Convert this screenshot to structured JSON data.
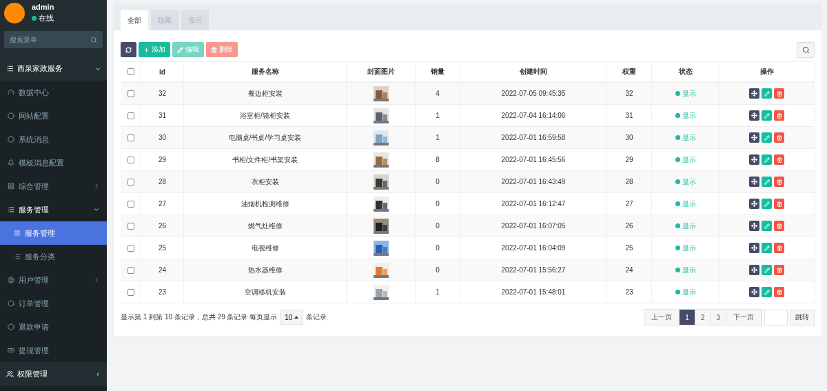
{
  "sidebar": {
    "user": {
      "name": "admin",
      "status": "在线",
      "online": true
    },
    "search": {
      "placeholder": "搜索菜单"
    },
    "menu": [
      {
        "label": "西泉家政服务",
        "expanded": true,
        "children": [
          {
            "label": "数据中心",
            "selected": false
          },
          {
            "label": "网站配置",
            "selected": false
          },
          {
            "label": "系统消息",
            "selected": false
          },
          {
            "label": "模板消息配置",
            "selected": false
          },
          {
            "label": "综合管理",
            "selected": false,
            "expanded": false
          },
          {
            "label": "服务管理",
            "selected": false,
            "expanded": true,
            "children": [
              {
                "label": "服务管理",
                "selected": true
              },
              {
                "label": "服务分类",
                "selected": false
              }
            ]
          },
          {
            "label": "用户管理",
            "selected": false,
            "expanded": false
          },
          {
            "label": "订单管理",
            "selected": false
          },
          {
            "label": "退款申请",
            "selected": false
          },
          {
            "label": "提现管理",
            "selected": false
          }
        ]
      },
      {
        "label": "权限管理",
        "expanded": false
      }
    ]
  },
  "tabs": [
    {
      "label": "全部",
      "selected": true
    },
    {
      "label": "隐藏",
      "selected": false
    },
    {
      "label": "显示",
      "selected": false
    }
  ],
  "toolbar": [
    {
      "kind": "refresh",
      "disabled": false
    },
    {
      "kind": "add",
      "label": "添加",
      "disabled": false
    },
    {
      "kind": "edit",
      "label": "编辑",
      "disabled": true
    },
    {
      "kind": "delete",
      "label": "删除",
      "disabled": true
    }
  ],
  "table": {
    "header_checked": false,
    "columns": [
      "id",
      "服务名称",
      "封面图片",
      "销量",
      "创建时间",
      "权重",
      "状态",
      "操作"
    ],
    "rows": [
      {
        "checked": false,
        "id": "32",
        "name": "餐边柜安装",
        "sales": "4",
        "created": "2022-07-05 09:45:35",
        "weight": "32",
        "status": {
          "label": "显示",
          "on": true
        }
      },
      {
        "checked": false,
        "id": "31",
        "name": "浴室柜/镜柜安装",
        "sales": "1",
        "created": "2022-07-04 16:14:06",
        "weight": "31",
        "status": {
          "label": "显示",
          "on": true
        }
      },
      {
        "checked": false,
        "id": "30",
        "name": "电脑桌/书桌/学习桌安装",
        "sales": "1",
        "created": "2022-07-01 16:59:58",
        "weight": "30",
        "status": {
          "label": "显示",
          "on": true
        }
      },
      {
        "checked": false,
        "id": "29",
        "name": "书柜/文件柜/书架安装",
        "sales": "8",
        "created": "2022-07-01 16:45:56",
        "weight": "29",
        "status": {
          "label": "显示",
          "on": true
        }
      },
      {
        "checked": false,
        "id": "28",
        "name": "衣柜安装",
        "sales": "0",
        "created": "2022-07-01 16:43:49",
        "weight": "28",
        "status": {
          "label": "显示",
          "on": true
        }
      },
      {
        "checked": false,
        "id": "27",
        "name": "油烟机检测维修",
        "sales": "0",
        "created": "2022-07-01 16:12:47",
        "weight": "27",
        "status": {
          "label": "显示",
          "on": true
        }
      },
      {
        "checked": false,
        "id": "26",
        "name": "燃气灶维修",
        "sales": "0",
        "created": "2022-07-01 16:07:05",
        "weight": "26",
        "status": {
          "label": "显示",
          "on": true
        }
      },
      {
        "checked": false,
        "id": "25",
        "name": "电视维修",
        "sales": "0",
        "created": "2022-07-01 16:04:09",
        "weight": "25",
        "status": {
          "label": "显示",
          "on": true
        }
      },
      {
        "checked": false,
        "id": "24",
        "name": "热水器维修",
        "sales": "0",
        "created": "2022-07-01 15:56:27",
        "weight": "24",
        "status": {
          "label": "显示",
          "on": true
        }
      },
      {
        "checked": false,
        "id": "23",
        "name": "空调移机安装",
        "sales": "1",
        "created": "2022-07-01 15:48:01",
        "weight": "23",
        "status": {
          "label": "显示",
          "on": true
        }
      }
    ]
  },
  "footer": {
    "summary_before": "显示第 1 到第 10 条记录，总共 29 条记录 每页显示",
    "page_size": "10",
    "summary_after": "条记录"
  },
  "pagination": {
    "prev": "上一页",
    "pages": [
      {
        "label": "1",
        "selected": true
      },
      {
        "label": "2",
        "selected": false
      },
      {
        "label": "3",
        "selected": false
      }
    ],
    "next": "下一页",
    "jump": "跳转"
  }
}
